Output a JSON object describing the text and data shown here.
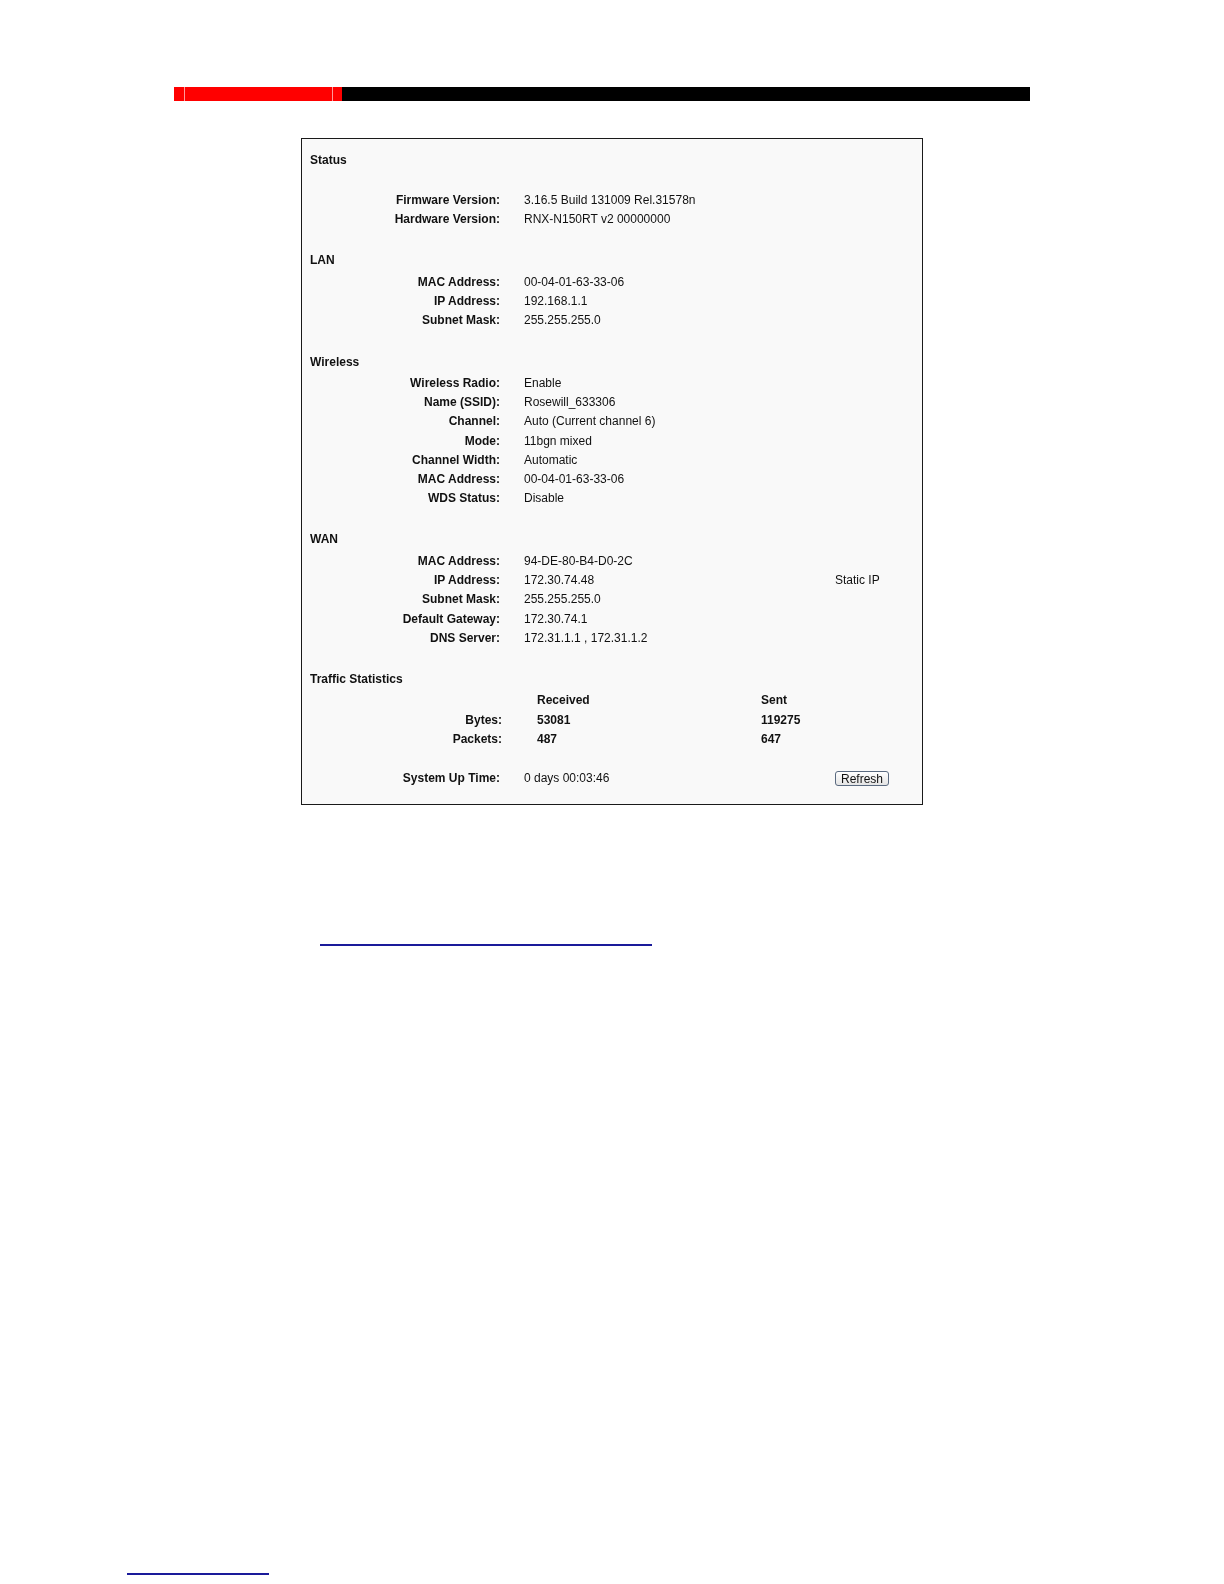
{
  "status_panel": {
    "sections": [
      {
        "kind": "fields",
        "title": "Status",
        "rows": [
          {
            "label": "Firmware Version:",
            "value": "3.16.5 Build 131009 Rel.31578n"
          },
          {
            "label": "Hardware Version:",
            "value": "RNX-N150RT v2 00000000"
          }
        ]
      },
      {
        "kind": "fields",
        "title": "LAN",
        "rows": [
          {
            "label": "MAC Address:",
            "value": "00-04-01-63-33-06"
          },
          {
            "label": "IP Address:",
            "value": "192.168.1.1"
          },
          {
            "label": "Subnet Mask:",
            "value": "255.255.255.0"
          }
        ]
      },
      {
        "kind": "fields",
        "title": "Wireless",
        "rows": [
          {
            "label": "Wireless Radio:",
            "value": "Enable"
          },
          {
            "label": "Name (SSID):",
            "value": "Rosewill_633306"
          },
          {
            "label": "Channel:",
            "value": "Auto (Current channel 6)"
          },
          {
            "label": "Mode:",
            "value": "11bgn mixed"
          },
          {
            "label": "Channel Width:",
            "value": "Automatic"
          },
          {
            "label": "MAC Address:",
            "value": "00-04-01-63-33-06"
          },
          {
            "label": "WDS Status:",
            "value": "Disable"
          }
        ]
      },
      {
        "kind": "fields",
        "title": "WAN",
        "rows": [
          {
            "label": "MAC Address:",
            "value": "94-DE-80-B4-D0-2C"
          },
          {
            "label": "IP Address:",
            "value": "172.30.74.48",
            "note": "Static IP"
          },
          {
            "label": "Subnet Mask:",
            "value": "255.255.255.0"
          },
          {
            "label": "Default Gateway:",
            "value": "172.30.74.1"
          },
          {
            "label": "DNS Server:",
            "value": "172.31.1.1 , 172.31.1.2"
          }
        ]
      },
      {
        "kind": "traffic",
        "title": "Traffic Statistics",
        "columns": [
          "Received",
          "Sent"
        ],
        "rows": [
          {
            "label": "Bytes:",
            "values": [
              "53081",
              "119275"
            ]
          },
          {
            "label": "Packets:",
            "values": [
              "487",
              "647"
            ]
          }
        ]
      }
    ],
    "uptime": {
      "label": "System Up Time:",
      "value": "0 days 00:03:46",
      "button": "Refresh"
    }
  }
}
